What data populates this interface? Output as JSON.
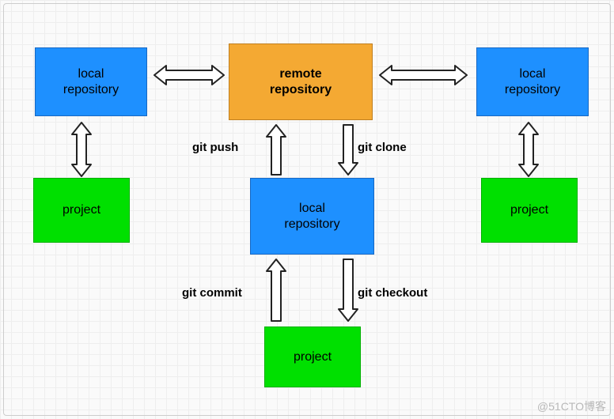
{
  "boxes": {
    "remote": {
      "text": "remote\nrepository"
    },
    "local_left": {
      "text": "local\nrepository"
    },
    "local_right": {
      "text": "local\nrepository"
    },
    "local_center": {
      "text": "local\nrepository"
    },
    "project_left": {
      "text": "project"
    },
    "project_right": {
      "text": "project"
    },
    "project_center": {
      "text": "project"
    }
  },
  "labels": {
    "git_push": "git push",
    "git_clone": "git clone",
    "git_commit": "git commit",
    "git_checkout": "git checkout"
  },
  "watermark": "@51CTO博客"
}
